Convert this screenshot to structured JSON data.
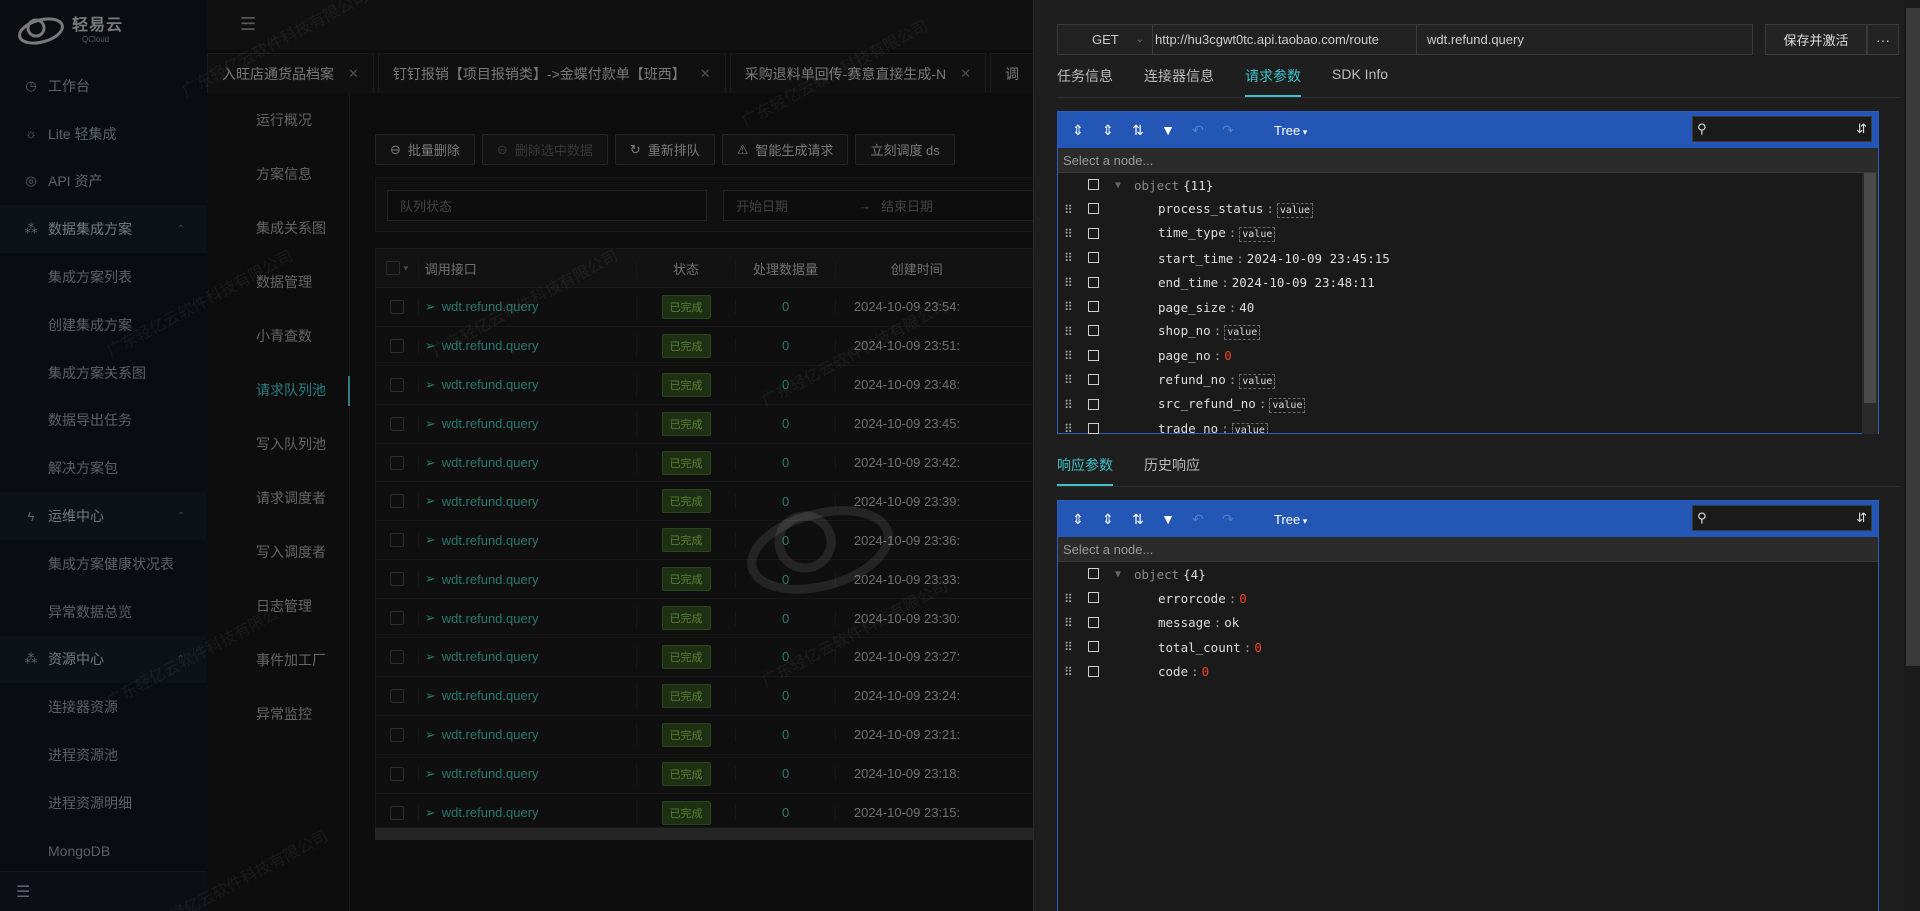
{
  "brand": {
    "name": "轻易云",
    "sub": "QCloud"
  },
  "sidebar": {
    "items": [
      {
        "label": "工作台",
        "icon": "clock-icon",
        "kind": "top"
      },
      {
        "label": "Lite 轻集成",
        "icon": "bulb-icon",
        "kind": "top"
      },
      {
        "label": "API 资产",
        "icon": "compass-icon",
        "kind": "top"
      },
      {
        "label": "数据集成方案",
        "icon": "cluster-icon",
        "kind": "group"
      },
      {
        "label": "集成方案列表",
        "kind": "sub"
      },
      {
        "label": "创建集成方案",
        "kind": "sub"
      },
      {
        "label": "集成方案关系图",
        "kind": "sub"
      },
      {
        "label": "数据导出任务",
        "kind": "sub"
      },
      {
        "label": "解决方案包",
        "kind": "sub"
      },
      {
        "label": "运维中心",
        "icon": "bolt-icon",
        "kind": "group"
      },
      {
        "label": "集成方案健康状况表",
        "kind": "sub"
      },
      {
        "label": "异常数据总览",
        "kind": "sub"
      },
      {
        "label": "资源中心",
        "icon": "cluster-icon",
        "kind": "group"
      },
      {
        "label": "连接器资源",
        "kind": "sub"
      },
      {
        "label": "进程资源池",
        "kind": "sub"
      },
      {
        "label": "进程资源明细",
        "kind": "sub"
      },
      {
        "label": "MongoDB",
        "kind": "sub"
      }
    ]
  },
  "tabs": [
    {
      "label": "入旺店通货品档案"
    },
    {
      "label": "钉钉报销【项目报销类】->金蝶付款单【班西】"
    },
    {
      "label": "采购退料单回传-赛意直接生成-N"
    },
    {
      "label": "调"
    }
  ],
  "subnav": [
    "运行概况",
    "方案信息",
    "集成关系图",
    "数据管理",
    "小青查数",
    "请求队列池",
    "写入队列池",
    "请求调度者",
    "写入调度者",
    "日志管理",
    "事件加工厂",
    "异常监控"
  ],
  "subnav_active": 5,
  "toolbar": {
    "batch_delete": "批量删除",
    "delete_selected": "删除选中数据",
    "requeue": "重新排队",
    "smart_generate": "智能生成请求",
    "dispatch_now": "立刻调度 ds"
  },
  "filters": {
    "queue_status_placeholder": "队列状态",
    "start_date_placeholder": "开始日期",
    "end_date_placeholder": "结束日期",
    "arrow": "→"
  },
  "table": {
    "headers": {
      "api": "调用接口",
      "status": "状态",
      "count": "处理数据量",
      "created": "创建时间"
    },
    "rows": [
      {
        "api": "wdt.refund.query",
        "status": "已完成",
        "count": "0",
        "created": "2024-10-09 23:54:"
      },
      {
        "api": "wdt.refund.query",
        "status": "已完成",
        "count": "0",
        "created": "2024-10-09 23:51:"
      },
      {
        "api": "wdt.refund.query",
        "status": "已完成",
        "count": "0",
        "created": "2024-10-09 23:48:"
      },
      {
        "api": "wdt.refund.query",
        "status": "已完成",
        "count": "0",
        "created": "2024-10-09 23:45:"
      },
      {
        "api": "wdt.refund.query",
        "status": "已完成",
        "count": "0",
        "created": "2024-10-09 23:42:"
      },
      {
        "api": "wdt.refund.query",
        "status": "已完成",
        "count": "0",
        "created": "2024-10-09 23:39:"
      },
      {
        "api": "wdt.refund.query",
        "status": "已完成",
        "count": "0",
        "created": "2024-10-09 23:36:"
      },
      {
        "api": "wdt.refund.query",
        "status": "已完成",
        "count": "0",
        "created": "2024-10-09 23:33:"
      },
      {
        "api": "wdt.refund.query",
        "status": "已完成",
        "count": "0",
        "created": "2024-10-09 23:30:"
      },
      {
        "api": "wdt.refund.query",
        "status": "已完成",
        "count": "0",
        "created": "2024-10-09 23:27:"
      },
      {
        "api": "wdt.refund.query",
        "status": "已完成",
        "count": "0",
        "created": "2024-10-09 23:24:"
      },
      {
        "api": "wdt.refund.query",
        "status": "已完成",
        "count": "0",
        "created": "2024-10-09 23:21:"
      },
      {
        "api": "wdt.refund.query",
        "status": "已完成",
        "count": "0",
        "created": "2024-10-09 23:18:"
      },
      {
        "api": "wdt.refund.query",
        "status": "已完成",
        "count": "0",
        "created": "2024-10-09 23:15:"
      }
    ]
  },
  "watermark": "广东轻亿云软件科技有限公司",
  "drawer": {
    "method": "GET",
    "url": "http://hu3cgwt0tc.api.taobao.com/route",
    "api_name": "wdt.refund.query",
    "save_label": "保存并激活",
    "more": "···",
    "tabs": [
      "任务信息",
      "连接器信息",
      "请求参数",
      "SDK Info"
    ],
    "tabs_active": 2,
    "resp_tabs": [
      "响应参数",
      "历史响应"
    ],
    "resp_tabs_active": 0,
    "editor_mode": "Tree",
    "nav_placeholder": "Select a node...",
    "request": {
      "root": "object",
      "count": "{11}",
      "fields": [
        {
          "key": "process_status",
          "type": "empty",
          "value": "value"
        },
        {
          "key": "time_type",
          "type": "empty",
          "value": "value"
        },
        {
          "key": "start_time",
          "type": "str",
          "value": "2024-10-09 23:45:15"
        },
        {
          "key": "end_time",
          "type": "str",
          "value": "2024-10-09 23:48:11"
        },
        {
          "key": "page_size",
          "type": "str",
          "value": "40"
        },
        {
          "key": "shop_no",
          "type": "empty",
          "value": "value"
        },
        {
          "key": "page_no",
          "type": "num",
          "value": "0"
        },
        {
          "key": "refund_no",
          "type": "empty",
          "value": "value"
        },
        {
          "key": "src_refund_no",
          "type": "empty",
          "value": "value"
        },
        {
          "key": "trade_no",
          "type": "empty",
          "value": "value"
        }
      ]
    },
    "response": {
      "root": "object",
      "count": "{4}",
      "fields": [
        {
          "key": "errorcode",
          "type": "num",
          "value": "0"
        },
        {
          "key": "message",
          "type": "str",
          "value": "ok"
        },
        {
          "key": "total_count",
          "type": "num",
          "value": "0"
        },
        {
          "key": "code",
          "type": "num",
          "value": "0"
        }
      ]
    }
  },
  "colors": {
    "accent": "#3fc1c9",
    "editor_menu": "#2456b5",
    "success_badge": "#2e4a1e",
    "number": "#ee4422"
  }
}
